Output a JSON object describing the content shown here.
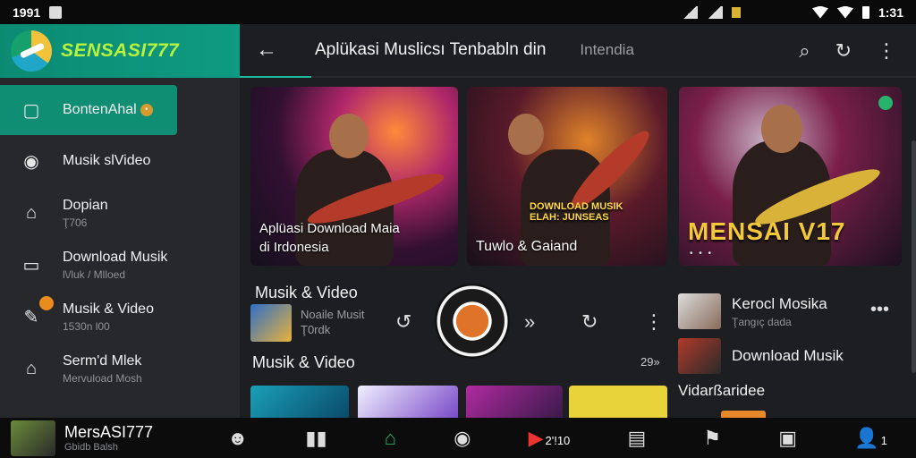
{
  "status": {
    "time_left": "1991",
    "time_right": "1:31"
  },
  "brand": {
    "name": "SENSASI777",
    "colors": {
      "accent": "#0f8e74",
      "brand_text": "#b7f23c"
    }
  },
  "sidebar": {
    "items": [
      {
        "label": "BontenAhal",
        "sub": "",
        "icon": "square-note-icon",
        "active": true
      },
      {
        "label": "Musik slVideo",
        "sub": "",
        "icon": "music-disc-icon"
      },
      {
        "label": "Dopian",
        "sub": "Ţ706",
        "icon": "home-icon"
      },
      {
        "label": "Download Musik",
        "sub": "l\\/luk / Mlloed",
        "icon": "screen-icon"
      },
      {
        "label": "Musik & Video",
        "sub": "1530n l00",
        "icon": "edit-icon",
        "badge": ""
      },
      {
        "label": "Serm'd Mlek",
        "sub": "Mervuload Mosh",
        "icon": "home2-icon"
      }
    ]
  },
  "topbar": {
    "title": "Aplükasi Muslicsı Tenbabln din",
    "subtitle": "Intendia",
    "icons": [
      "search-icon",
      "refresh-icon",
      "more-vert-icon"
    ]
  },
  "cards": [
    {
      "caption_line1": "Aplüasi Download Maia",
      "caption_line2": "di Irdonesia"
    },
    {
      "caption": "Tuwlo & Gaiand",
      "overlay_top": "DOWNLOAD MUSIK",
      "overlay_sub": "ELAH: JUNSEAS"
    },
    {
      "overlay": "MENSAI V17"
    }
  ],
  "section1": {
    "title": "Musik & Video"
  },
  "player": {
    "line1": "Noaile Musit",
    "line2": "Ţ0rdk"
  },
  "section2": {
    "title": "Musik & Video",
    "count": "29»"
  },
  "side_list": [
    {
      "title": "Kerocl Mosika",
      "sub": "Ţangıç dada"
    },
    {
      "title": "Download Musik",
      "sub": ""
    }
  ],
  "video_title": "Vidarßaridee",
  "now_playing": {
    "title": "MersASI777",
    "sub": "Gbidb Balsh"
  },
  "bottom_nav": [
    {
      "icon": "mask-icon"
    },
    {
      "icon": "media-icon"
    },
    {
      "icon": "home-icon"
    },
    {
      "icon": "disc-icon"
    },
    {
      "icon": "play-icon",
      "label": "2'!10"
    },
    {
      "icon": "library-icon"
    },
    {
      "icon": "flag-icon"
    },
    {
      "icon": "inbox-icon"
    },
    {
      "icon": "profile-icon",
      "label": "1"
    }
  ]
}
